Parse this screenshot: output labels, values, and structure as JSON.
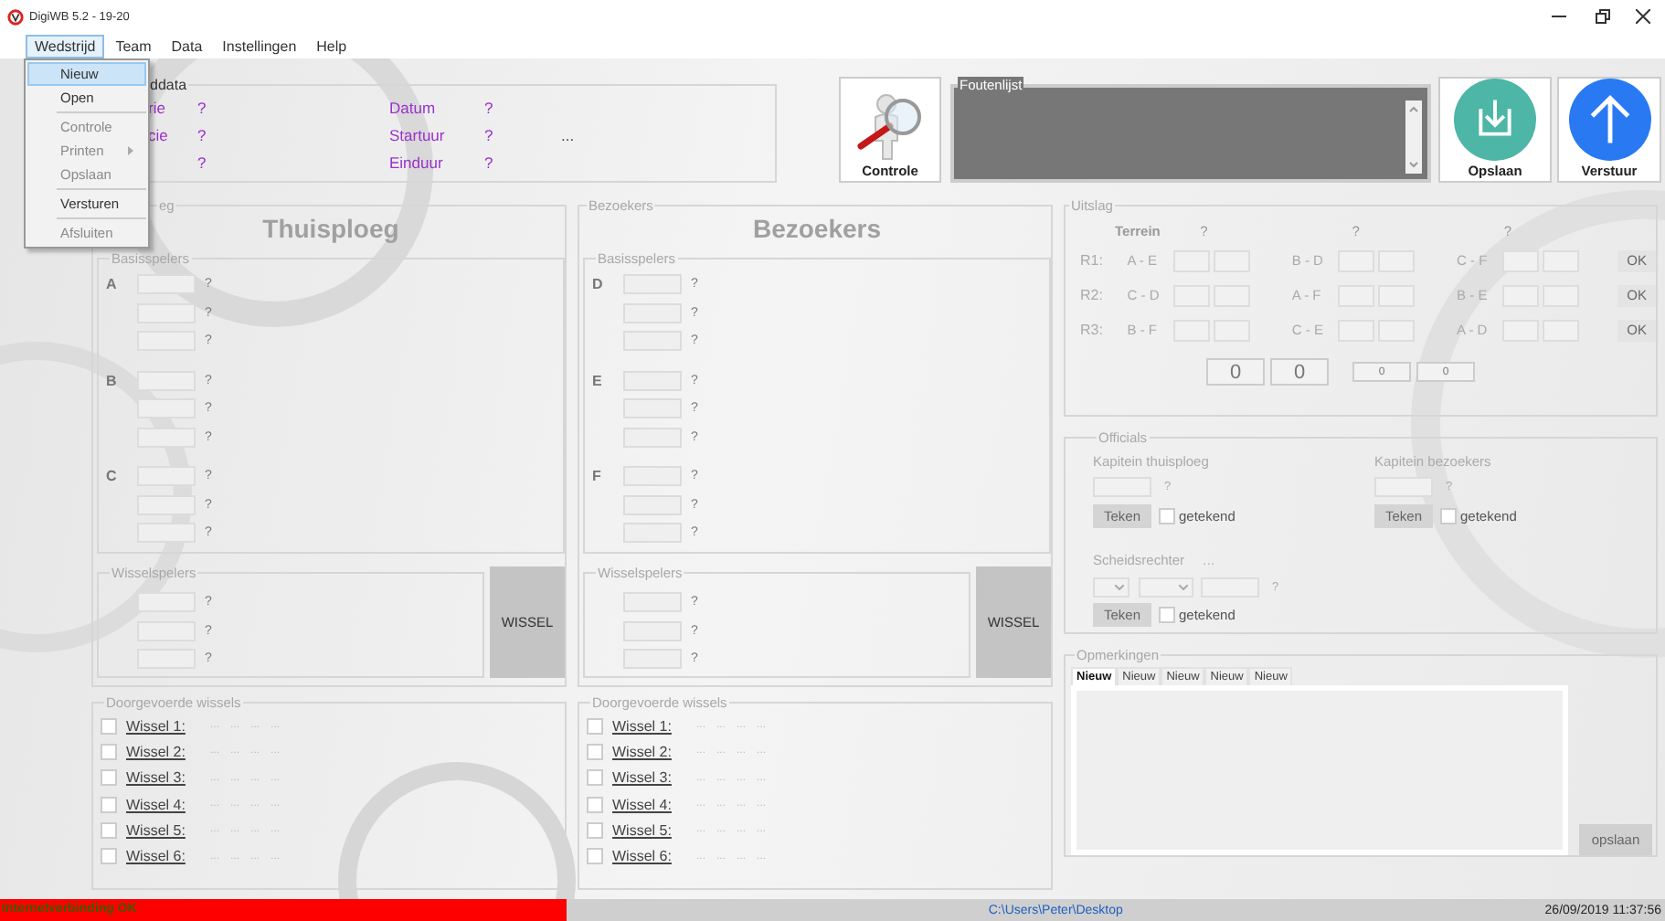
{
  "window": {
    "title": "DigiWB 5.2 - 19-20"
  },
  "menu_bar": [
    {
      "label": "Wedstrijd",
      "selected": true
    },
    {
      "label": "Team",
      "selected": false
    },
    {
      "label": "Data",
      "selected": false
    },
    {
      "label": "Instellingen",
      "selected": false
    },
    {
      "label": "Help",
      "selected": false
    }
  ],
  "open_menu": [
    {
      "kind": "item",
      "label": "Nieuw",
      "selected": true,
      "disabled": false
    },
    {
      "kind": "item",
      "label": "Open",
      "selected": false,
      "disabled": false
    },
    {
      "kind": "separator"
    },
    {
      "kind": "item",
      "label": "Controle",
      "selected": false,
      "disabled": true
    },
    {
      "kind": "submenu",
      "label": "Printen",
      "selected": false,
      "disabled": true
    },
    {
      "kind": "item",
      "label": "Opslaan",
      "selected": false,
      "disabled": true
    },
    {
      "kind": "separator"
    },
    {
      "kind": "item",
      "label": "Versturen",
      "selected": false,
      "disabled": false
    },
    {
      "kind": "separator"
    },
    {
      "kind": "item",
      "label": "Afsluiten",
      "selected": false,
      "disabled": true
    }
  ],
  "match_data": {
    "title": "ddata",
    "rows": [
      {
        "label": "rie",
        "value": "?",
        "label_2": "Datum",
        "value_2": "?"
      },
      {
        "label": "cie",
        "value": "?",
        "label_2": "Startuur",
        "value_2": "?",
        "note": "..."
      },
      {
        "value": "?",
        "label_2": "Einduur",
        "value_2": "?"
      }
    ]
  },
  "toolbar": {
    "check_button": "Controle",
    "error_list": {
      "title": "Foutenlijst"
    },
    "save_button": "Opslaan",
    "send_button": "Verstuur"
  },
  "teams": [
    {
      "group_title": "eg",
      "heading": "Thuisploeg",
      "starters_title": "Basisspelers",
      "starters": [
        {
          "letter": "A",
          "players": [
            "?",
            "?",
            "?"
          ]
        },
        {
          "letter": "B",
          "players": [
            "?",
            "?",
            "?"
          ]
        },
        {
          "letter": "C",
          "players": [
            "?",
            "?",
            "?"
          ]
        }
      ],
      "substitutes_title": "Wisselspelers",
      "substitutes": [
        "?",
        "?",
        "?"
      ],
      "swap_button": "WISSEL",
      "substitutions_title": "Doorgevoerde wissels",
      "substitutions": [
        {
          "label": "Wissel 1:",
          "checked": false,
          "details": [
            "...",
            "...",
            "...",
            "..."
          ]
        },
        {
          "label": "Wissel 2:",
          "checked": false,
          "details": [
            "...",
            "...",
            "...",
            "..."
          ]
        },
        {
          "label": "Wissel 3:",
          "checked": false,
          "details": [
            "...",
            "...",
            "...",
            "..."
          ]
        },
        {
          "label": "Wissel 4:",
          "checked": false,
          "details": [
            "...",
            "...",
            "...",
            "..."
          ]
        },
        {
          "label": "Wissel 5:",
          "checked": false,
          "details": [
            "...",
            "...",
            "...",
            "..."
          ]
        },
        {
          "label": "Wissel 6:",
          "checked": false,
          "details": [
            "...",
            "...",
            "...",
            "..."
          ]
        }
      ]
    },
    {
      "group_title": "Bezoekers",
      "heading": "Bezoekers",
      "starters_title": "Basisspelers",
      "starters": [
        {
          "letter": "D",
          "players": [
            "?",
            "?",
            "?"
          ]
        },
        {
          "letter": "E",
          "players": [
            "?",
            "?",
            "?"
          ]
        },
        {
          "letter": "F",
          "players": [
            "?",
            "?",
            "?"
          ]
        }
      ],
      "substitutes_title": "Wisselspelers",
      "substitutes": [
        "?",
        "?",
        "?"
      ],
      "swap_button": "WISSEL",
      "substitutions_title": "Doorgevoerde wissels",
      "substitutions": [
        {
          "label": "Wissel 1:",
          "checked": false,
          "details": [
            "...",
            "...",
            "...",
            "..."
          ]
        },
        {
          "label": "Wissel 2:",
          "checked": false,
          "details": [
            "...",
            "...",
            "...",
            "..."
          ]
        },
        {
          "label": "Wissel 3:",
          "checked": false,
          "details": [
            "...",
            "...",
            "...",
            "..."
          ]
        },
        {
          "label": "Wissel 4:",
          "checked": false,
          "details": [
            "...",
            "...",
            "...",
            "..."
          ]
        },
        {
          "label": "Wissel 5:",
          "checked": false,
          "details": [
            "...",
            "...",
            "...",
            "..."
          ]
        },
        {
          "label": "Wissel 6:",
          "checked": false,
          "details": [
            "...",
            "...",
            "...",
            "..."
          ]
        }
      ]
    }
  ],
  "result": {
    "title": "Uitslag",
    "header": {
      "label": "Terrein",
      "columns": [
        "?",
        "?",
        "?"
      ]
    },
    "rounds": [
      {
        "label": "R1:",
        "matches": [
          "A - E",
          "B - D",
          "C - F"
        ],
        "button": "OK"
      },
      {
        "label": "R2:",
        "matches": [
          "C - D",
          "A - F",
          "B - E"
        ],
        "button": "OK"
      },
      {
        "label": "R3:",
        "matches": [
          "B - F",
          "C - E",
          "A - D"
        ],
        "button": "OK"
      }
    ],
    "totals": [
      "0",
      "0"
    ],
    "sub_totals": [
      "0",
      "0"
    ]
  },
  "officials": {
    "title": "Officials",
    "captains": [
      {
        "label": "Kapitein thuisploeg",
        "hint": "?",
        "button": "Teken",
        "check_label": "getekend",
        "checked": false
      },
      {
        "label": "Kapitein bezoekers",
        "hint": "?",
        "button": "Teken",
        "check_label": "getekend",
        "checked": false
      }
    ],
    "referee": {
      "label": "Scheidsrechter",
      "note": "...",
      "hint": "?",
      "button": "Teken",
      "check_label": "getekend",
      "checked": false
    }
  },
  "remarks": {
    "title": "Opmerkingen",
    "tabs": [
      {
        "label": "Nieuw",
        "selected": true
      },
      {
        "label": "Nieuw",
        "selected": false
      },
      {
        "label": "Nieuw",
        "selected": false
      },
      {
        "label": "Nieuw",
        "selected": false
      },
      {
        "label": "Nieuw",
        "selected": false
      }
    ],
    "button": "opslaan"
  },
  "status_bar": {
    "connection": "Internetverbinding OK",
    "path": "C:\\Users\\Peter\\Desktop",
    "datetime": "26/09/2019 11:37:56"
  }
}
